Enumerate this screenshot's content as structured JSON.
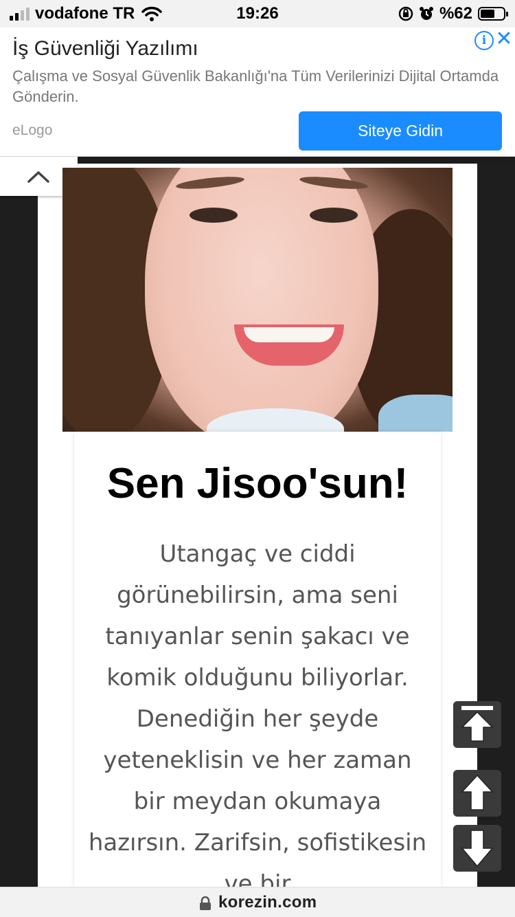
{
  "status_bar": {
    "carrier": "vodafone TR",
    "time": "19:26",
    "battery": "%62",
    "battery_level": 0.62
  },
  "ad": {
    "title": "İş Güvenliği Yazılımı",
    "description": "Çalışma ve Sosyal Güvenlik Bakanlığı'na Tüm Verilerinizi Dijital Ortamda Gönderin.",
    "advertiser": "eLogo",
    "cta_label": "Siteye Gidin",
    "accent_color": "#1a8cff"
  },
  "result": {
    "title": "Sen Jisoo'sun!",
    "description": "Utangaç ve ciddi görünebilirsin, ama seni tanıyanlar senin şakacı ve komik olduğunu biliyorlar. Denediğin her şeyde yeteneklisin ve her zaman bir meydan okumaya hazırsın. Zarifsin, sofistikesin ve bir"
  },
  "icons": {
    "collapse": "chevron-up-icon",
    "scroll_top": "scroll-to-top-icon",
    "scroll_up": "arrow-up-icon",
    "scroll_down": "arrow-down-icon",
    "lock": "lock-icon"
  },
  "url_bar": {
    "url": "korezin.com"
  }
}
